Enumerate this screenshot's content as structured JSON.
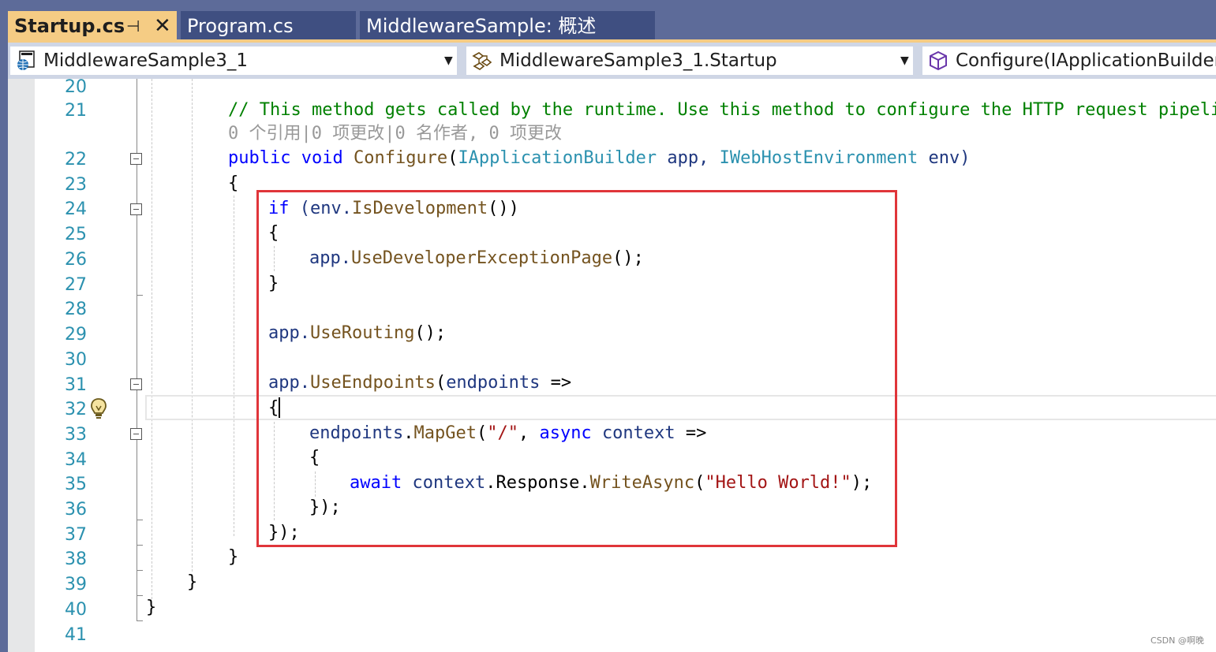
{
  "tabs": [
    {
      "label": "Startup.cs",
      "active": true
    },
    {
      "label": "Program.cs",
      "active": false
    },
    {
      "label": "MiddlewareSample: 概述",
      "active": false
    }
  ],
  "tab_icons": {
    "pin": "⊣",
    "close": "✕"
  },
  "nav": {
    "project": "MiddlewareSample3_1",
    "type": "MiddlewareSample3_1.Startup",
    "member": "Configure(IApplicationBuilder app, IWebHostEnvironment env)"
  },
  "line_numbers": [
    "20",
    "21",
    "22",
    "23",
    "24",
    "25",
    "26",
    "27",
    "28",
    "29",
    "30",
    "31",
    "32",
    "33",
    "34",
    "35",
    "36",
    "37",
    "38",
    "39",
    "40",
    "41"
  ],
  "code": {
    "comment": "// This method gets called by the runtime. Use this method to configure the HTTP request pipeline.",
    "codelens": "0 个引用|0 项更改|0 名作者, 0 项更改",
    "l22": {
      "kw1": "public",
      "kw2": "void",
      "m": "Configure",
      "p1": "(",
      "t1": "IApplicationBuilder",
      "a1": " app, ",
      "t2": "IWebHostEnvironment",
      "a2": " env)"
    },
    "open_brace": "{",
    "close_brace": "}",
    "l24": {
      "kw": "if",
      "a": " (env.",
      "m": "IsDevelopment",
      "b": "())"
    },
    "l26": {
      "a": "app.",
      "m": "UseDeveloperExceptionPage",
      "b": "();"
    },
    "l29": {
      "a": "app.",
      "m": "UseRouting",
      "b": "();"
    },
    "l31": {
      "a": "app.",
      "m": "UseEndpoints",
      "b": "(",
      "p": "endpoints",
      "c": " =>"
    },
    "l33": {
      "p": "endpoints",
      "a": ".",
      "m": "MapGet",
      "b": "(",
      "s": "\"/\"",
      "c": ", ",
      "kw": "async",
      "d": " ",
      "p2": "context",
      "e": " =>"
    },
    "l35": {
      "kw": "await",
      "a": " ",
      "p": "context",
      "b": ".Response.",
      "m": "WriteAsync",
      "c": "(",
      "s": "\"Hello World!\"",
      "d": ");"
    },
    "l36": "});",
    "l37": "});"
  },
  "colors": {
    "keyword": "#0000ff",
    "type": "#2b91af",
    "method": "#74531f",
    "parameter": "#1f377f",
    "string": "#a31515",
    "comment": "#008000",
    "highlight_box": "#e0353a",
    "active_tab": "#f5cc84"
  },
  "watermark": "CSDN @啊晚"
}
